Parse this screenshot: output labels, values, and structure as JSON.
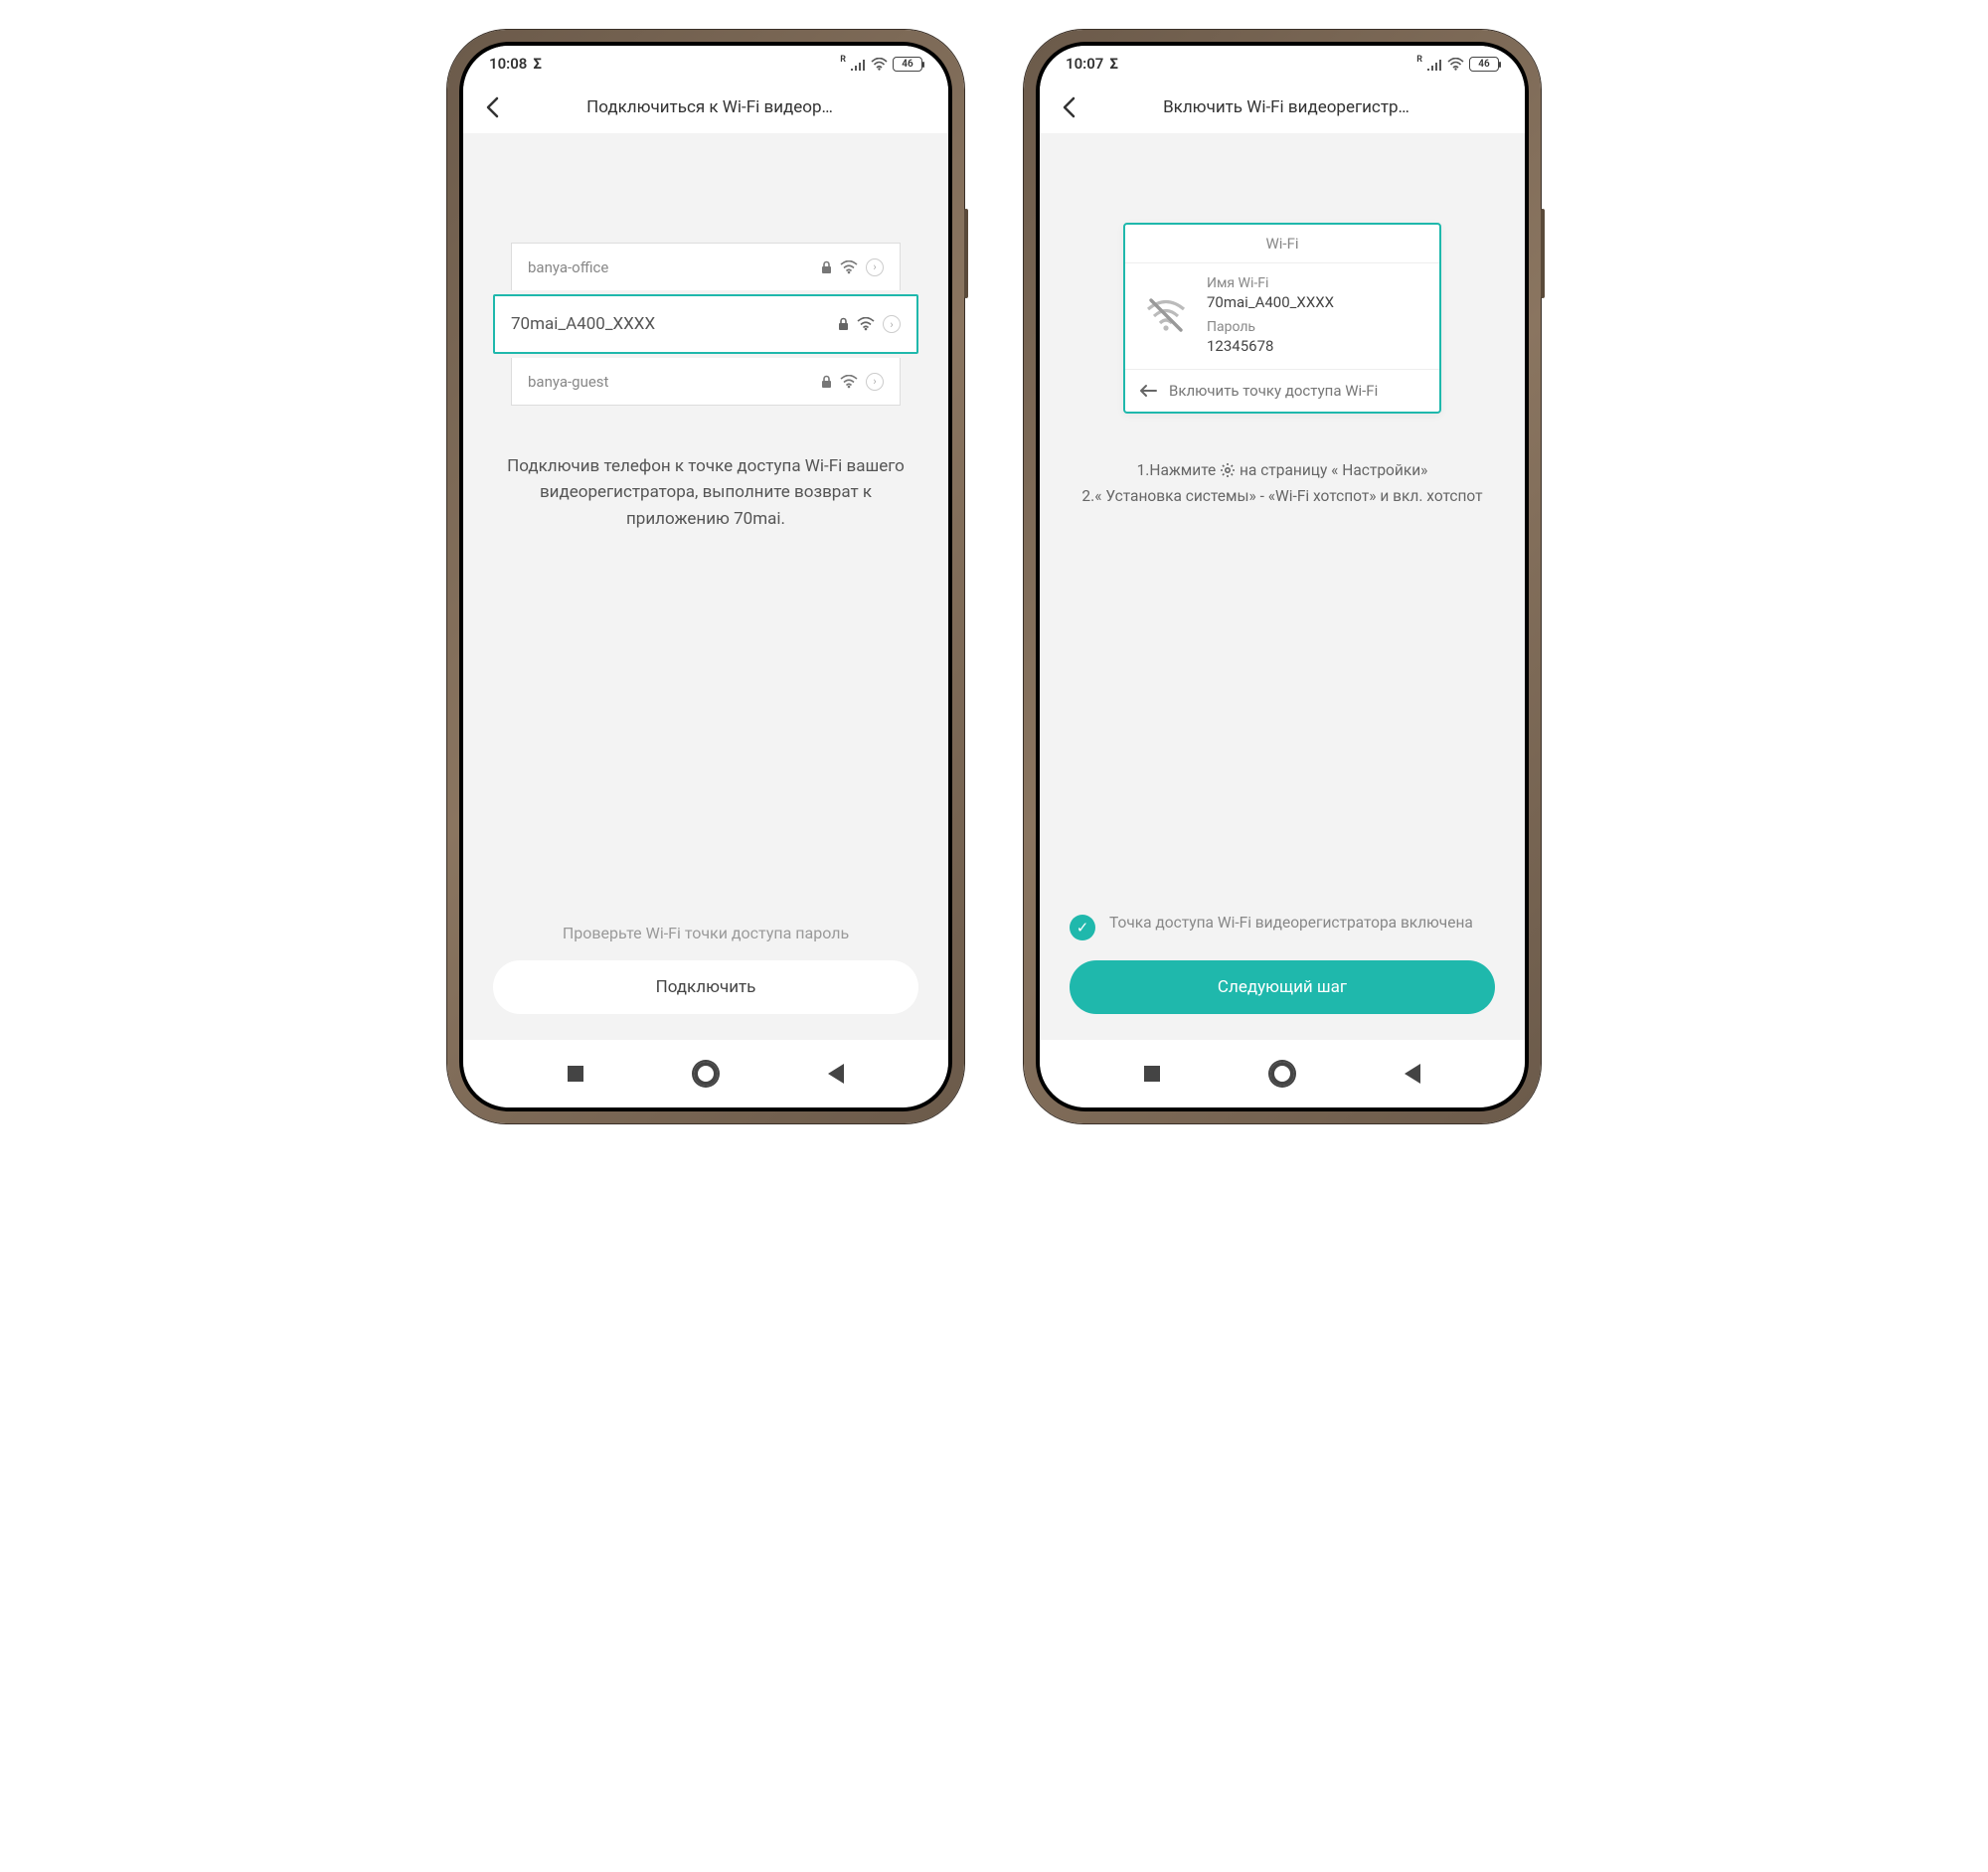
{
  "left": {
    "status": {
      "time": "10:08",
      "battery": "46",
      "network_label": "R"
    },
    "header": {
      "title": "Подключиться к Wi-Fi видеор…"
    },
    "wifi_items": [
      {
        "name": "banya-office"
      },
      {
        "name": "70mai_A400_XXXX"
      },
      {
        "name": "banya-guest"
      }
    ],
    "instruction": "Подключив телефон к точке доступа Wi-Fi вашего видеорегистратора, выполните возврат к приложению 70mai.",
    "hint": "Проверьте Wi-Fi точки доступа пароль",
    "button": "Подключить"
  },
  "right": {
    "status": {
      "time": "10:07",
      "battery": "46",
      "network_label": "R"
    },
    "header": {
      "title": "Включить Wi-Fi видеорегистр…"
    },
    "card": {
      "title": "Wi-Fi",
      "name_label": "Имя Wi-Fi",
      "name_value": "70mai_A400_XXXX",
      "password_label": "Пароль",
      "password_value": "12345678",
      "footer": "Включить точку доступа Wi-Fi"
    },
    "instructions": {
      "line1_prefix": "1.Нажмите ",
      "line1_suffix": " на страницу « Настройки»",
      "line2": "2.« Установка системы» - «Wi-Fi хотспот» и вкл. хотспот"
    },
    "confirm": "Точка доступа Wi-Fi видеорегистратора включена",
    "button": "Следующий шаг"
  }
}
